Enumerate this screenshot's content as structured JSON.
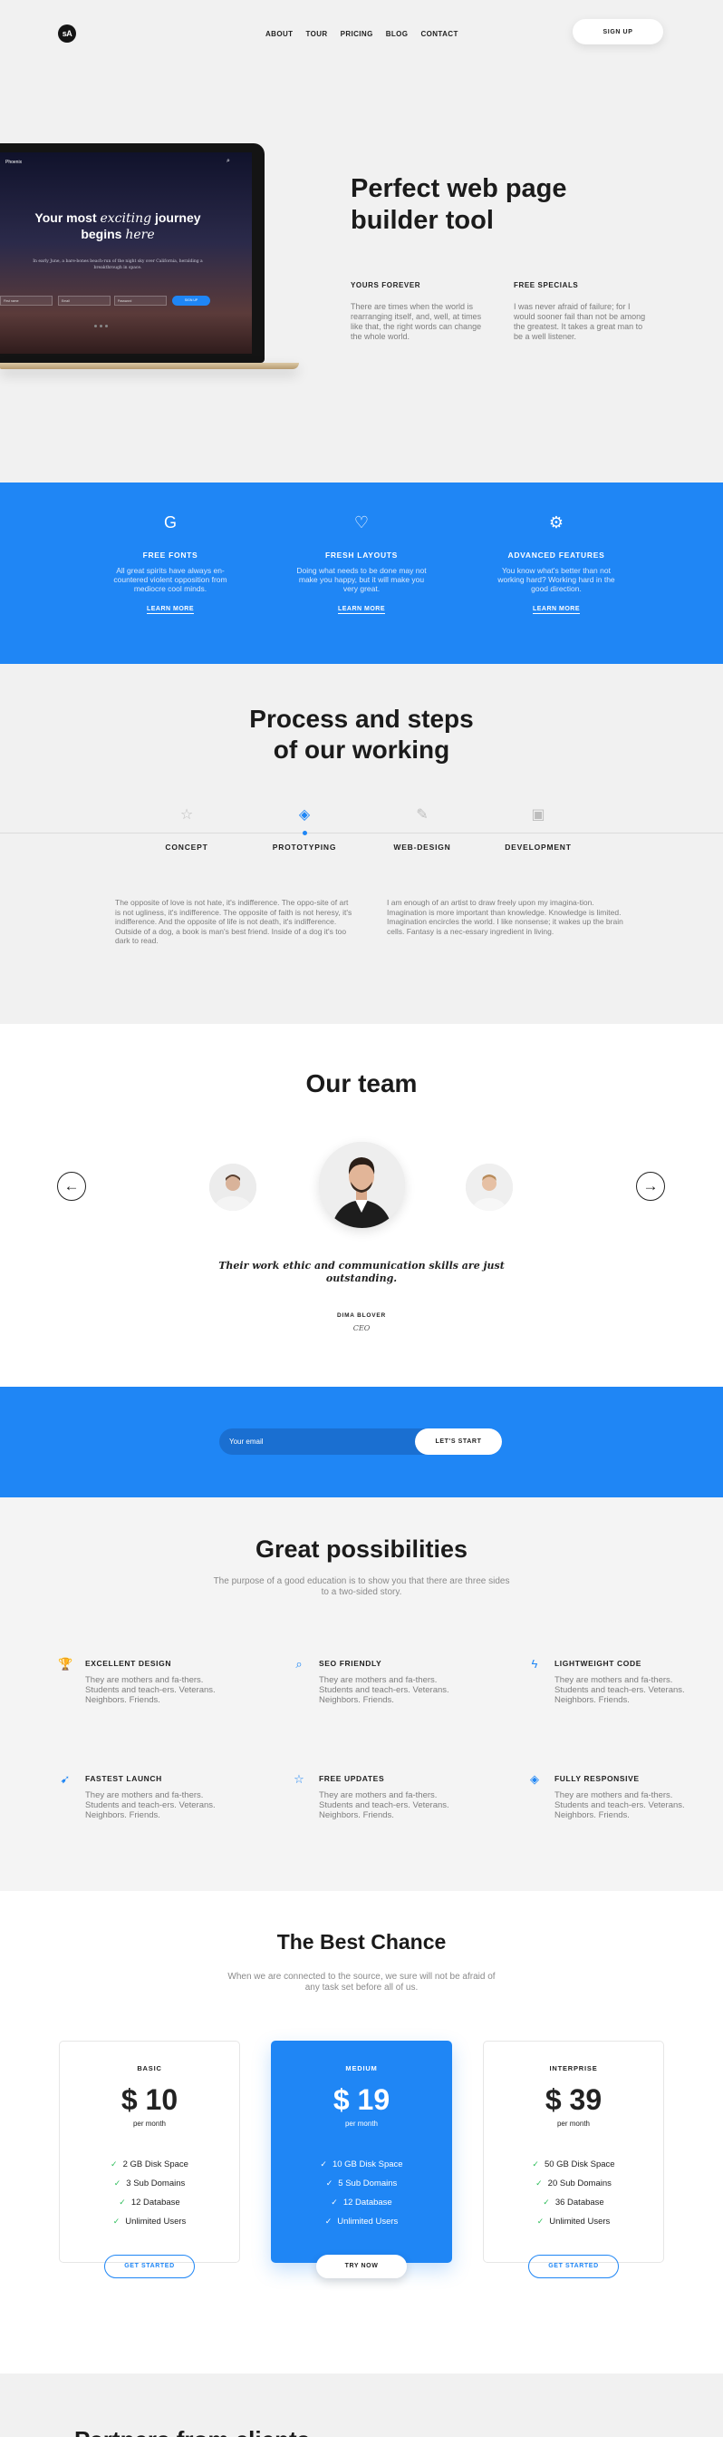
{
  "header": {
    "logo_text": "sA",
    "nav": [
      "ABOUT",
      "TOUR",
      "PRICING",
      "BLOG",
      "CONTACT"
    ],
    "signup_label": "SIGN UP"
  },
  "hero": {
    "title_line1": "Perfect web page",
    "title_line2": "builder tool",
    "laptop": {
      "brand": "Phoenix",
      "title_pre": "Your most ",
      "title_em": "exciting",
      "title_post": " journey",
      "title_line2_pre": "begins ",
      "title_line2_em": "here",
      "subtitle": "In early June, a bare-bones beach-run of the night sky over California, heralding a breakthrough in space.",
      "field1": "First name",
      "field2": "Email",
      "field3": "Password",
      "button": "SIGN UP"
    },
    "col1": {
      "heading": "YOURS FOREVER",
      "text": "There are times when the world is rearranging itself, and, well, at times like that, the right words can change the whole world."
    },
    "col2": {
      "heading": "FREE SPECIALS",
      "text": "I was never afraid of failure; for I would sooner fail than not be among the greatest. It takes a great man to be a well listener."
    }
  },
  "features": [
    {
      "icon": "G",
      "title": "FREE FONTS",
      "text": "All great spirits have always en-countered violent opposition from mediocre cool minds.",
      "link": "LEARN MORE"
    },
    {
      "icon": "♡",
      "title": "FRESH LAYOUTS",
      "text": "Doing what needs to be done may not make you happy, but it will make you very great.",
      "link": "LEARN MORE"
    },
    {
      "icon": "⚙",
      "title": "ADVANCED FEATURES",
      "text": "You know what's better than not working hard? Working hard in the good direction.",
      "link": "LEARN MORE"
    }
  ],
  "process": {
    "title_line1": "Process and steps",
    "title_line2": "of our working",
    "steps": [
      {
        "icon": "☆",
        "label": "CONCEPT"
      },
      {
        "icon": "◈",
        "label": "PROTOTYPING"
      },
      {
        "icon": "✎",
        "label": "WEB-DESIGN"
      },
      {
        "icon": "▣",
        "label": "DEVELOPMENT"
      }
    ],
    "para1": "The opposite of love is not hate, it's indifference. The oppo-site of art is not ugliness, it's indifference. The opposite of faith is not heresy, it's indifference. And the opposite of life is not death, it's indifference. Outside of a dog, a book is man's best friend. Inside of a dog it's too dark to read.",
    "para2": "I am enough of an artist to draw freely upon my imagina-tion. Imagination is more important than knowledge. Knowledge is limited. Imagination encircles the world. I like nonsense; it wakes up the brain cells. Fantasy is a nec-essary ingredient in living."
  },
  "team": {
    "title": "Our team",
    "prev_icon": "←",
    "next_icon": "→",
    "quote_line1": "Their work ethic and communication skills are just",
    "quote_line2": "outstanding.",
    "name": "DIMA BLOVER",
    "role": "CEO"
  },
  "subscribe": {
    "placeholder": "Your email",
    "button": "LET'S START"
  },
  "possibilities": {
    "title": "Great possibilities",
    "subtitle": "The purpose of a good education is to show you that there are three sides to a two-sided story.",
    "items": [
      {
        "icon": "🏆",
        "title": "EXCELLENT DESIGN",
        "text": "They are mothers and fa-thers. Students and teach-ers. Veterans. Neighbors. Friends."
      },
      {
        "icon": "⌕",
        "title": "SEO FRIENDLY",
        "text": "They are mothers and fa-thers. Students and teach-ers. Veterans. Neighbors. Friends."
      },
      {
        "icon": "ϟ",
        "title": "LIGHTWEIGHT CODE",
        "text": "They are mothers and fa-thers. Students and teach-ers. Veterans. Neighbors. Friends."
      },
      {
        "icon": "➹",
        "title": "FASTEST LAUNCH",
        "text": "They are mothers and fa-thers. Students and teach-ers. Veterans. Neighbors. Friends."
      },
      {
        "icon": "☆",
        "title": "FREE UPDATES",
        "text": "They are mothers and fa-thers. Students and teach-ers. Veterans. Neighbors. Friends."
      },
      {
        "icon": "◈",
        "title": "FULLY RESPONSIVE",
        "text": "They are mothers and fa-thers. Students and teach-ers. Veterans. Neighbors. Friends."
      }
    ]
  },
  "pricing": {
    "title": "The Best Chance",
    "subtitle": "When we are connected to the source, we sure will not be afraid of any task set before all of us.",
    "plans": [
      {
        "name": "BASIC",
        "price": "$ 10",
        "period": "per month",
        "features": [
          "2 GB Disk Space",
          "3 Sub Domains",
          "12 Database",
          "Unlimited Users"
        ],
        "button": "GET STARTED"
      },
      {
        "name": "MEDIUM",
        "price": "$ 19",
        "period": "per month",
        "features": [
          "10 GB Disk Space",
          "5 Sub Domains",
          "12 Database",
          "Unlimited Users"
        ],
        "button": "TRY NOW"
      },
      {
        "name": "INTERPRISE",
        "price": "$ 39",
        "period": "per month",
        "features": [
          "50 GB Disk Space",
          "20 Sub Domains",
          "36 Database",
          "Unlimited Users"
        ],
        "button": "GET STARTED"
      }
    ]
  },
  "bottom": {
    "title": "Partners from clients"
  },
  "colors": {
    "accent": "#1f86f5",
    "background": "#f1f1f1",
    "check": "#2dbd5a"
  }
}
